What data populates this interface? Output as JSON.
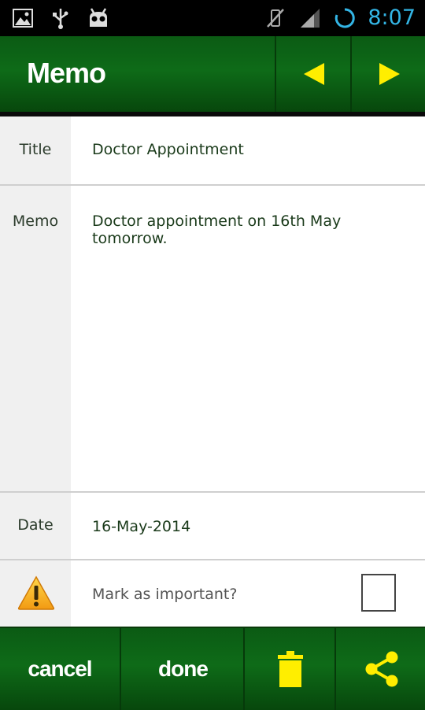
{
  "status_bar": {
    "time": "8:07",
    "icons": [
      "image-icon",
      "usb-icon",
      "android-icon",
      "vibrate-off-icon",
      "signal-icon",
      "sync-icon"
    ]
  },
  "action_bar": {
    "title": "Memo",
    "prev_icon": "triangle-left-icon",
    "next_icon": "triangle-right-icon"
  },
  "form": {
    "title_label": "Title",
    "title_value": "Doctor Appointment",
    "memo_label": "Memo",
    "memo_value": "Doctor appointment on 16th May tomorrow.",
    "date_label": "Date",
    "date_value": "16-May-2014",
    "important_label": "Mark as important?",
    "important_checked": false,
    "important_icon": "warning-icon"
  },
  "bottom_bar": {
    "cancel_label": "cancel",
    "done_label": "done",
    "delete_icon": "trash-icon",
    "share_icon": "share-icon"
  },
  "colors": {
    "bar_green": "#0e6b18",
    "accent_yellow": "#ffee00",
    "time_blue": "#33b5e5"
  }
}
